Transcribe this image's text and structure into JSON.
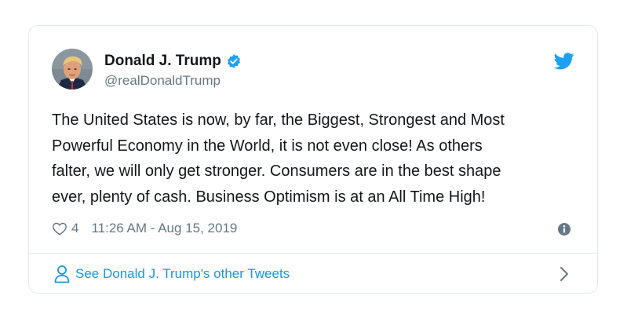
{
  "tweet": {
    "author_name": "Donald J. Trump",
    "handle": "@realDonaldTrump",
    "text": "The United States is now, by far, the Biggest, Strongest and Most\nPowerful Economy in the World, it is not even close! As others\nfalter, we will only get stronger. Consumers are in the best shape\never, plenty of cash. Business Optimism is at an All Time High!",
    "likes": "4",
    "timestamp": "11:26 AM - Aug 15, 2019"
  },
  "footer": {
    "label": "See Donald J. Trump's other Tweets"
  },
  "colors": {
    "accent": "#1da1f2",
    "link": "#1b95e0",
    "muted": "#657786",
    "border": "#e1e8ed"
  },
  "icons": [
    "avatar",
    "verified-badge-icon",
    "twitter-bird-icon",
    "heart-icon",
    "info-icon",
    "person-icon",
    "chevron-right-icon"
  ]
}
